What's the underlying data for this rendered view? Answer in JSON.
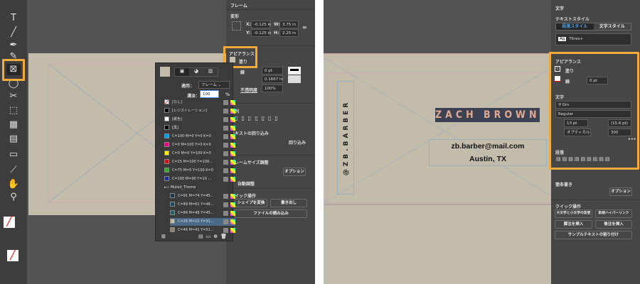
{
  "left": {
    "tools": [
      "select",
      "type-T",
      "line",
      "pen",
      "pencil",
      "rectangle-frame",
      "ellipse",
      "scissors",
      "free-transform",
      "gradient",
      "gradient-feather",
      "note",
      "eyedropper",
      "hand",
      "zoom"
    ],
    "properties": {
      "section_title": "フレーム",
      "transform_title": "変形",
      "x_label": "X:",
      "x": "-0.125 in",
      "y_label": "Y:",
      "y": "-0.125 in",
      "w_label": "W:",
      "w": "3.75 in",
      "h_label": "H:",
      "h": "2.25 in",
      "appearance_title": "アピアランス",
      "fill_label": "塗り",
      "stroke_label": "線",
      "stroke_weight": "0 pt",
      "corner": "0.1667 in",
      "opacity_label": "不透明度",
      "opacity": "100%",
      "align_title": "整列",
      "wrap_title": "テキストの回り込み",
      "wrap_checkbox": "回り込み",
      "fit_title": "フレームサイズ調整",
      "options_button": "オプション",
      "auto_fit": "自動調整",
      "quick_title": "クイック操作",
      "convert_shape": "シェイプを変換",
      "export_button": "書き出し",
      "place_file": "ファイルの読み込み"
    },
    "swatches": {
      "apply_label": "適用：",
      "apply_value": "フレーム",
      "tint_label": "濃淡：",
      "tint_value": "100",
      "tint_unit": "%",
      "items": [
        {
          "name": "[なし]",
          "color": "none"
        },
        {
          "name": "[レジストレーション]",
          "color": "#000000"
        },
        {
          "name": "[紙色]",
          "color": "#ffffff"
        },
        {
          "name": "[黒]",
          "color": "#000000"
        },
        {
          "name": "C=100 M=0 Y=0 K=0",
          "color": "#00a0e6"
        },
        {
          "name": "C=0 M=100 Y=0 K=0",
          "color": "#e4007f"
        },
        {
          "name": "C=0 M=0 Y=100 K=0",
          "color": "#fff100"
        },
        {
          "name": "C=15 M=100 Y=100...",
          "color": "#c8161d"
        },
        {
          "name": "C=75 M=5 Y=100 K=0",
          "color": "#3aa935"
        },
        {
          "name": "C=100 M=90 Y=10 ...",
          "color": "#1d2f86"
        }
      ],
      "group": "Muted_Theme",
      "group_items": [
        {
          "name": "C=91 M=74 Y=45...",
          "color": "#1f3447"
        },
        {
          "name": "C=89 M=61 Y=48...",
          "color": "#234a58"
        },
        {
          "name": "C=84 M=48 Y=45...",
          "color": "#2c5e68"
        },
        {
          "name": "C=26 M=22 Y=31...",
          "color": "#c3bcab",
          "selected": true
        },
        {
          "name": "C=46 M=41 Y=51...",
          "color": "#8d8574"
        }
      ]
    }
  },
  "right": {
    "card": {
      "handle": "@ZB.BARBER",
      "name": "ZACH BROWN",
      "email": "zb.barber@mail.com",
      "city": "Austin, TX"
    },
    "properties": {
      "section_title": "文字",
      "text_style_title": "テキストスタイル",
      "para_style_tab": "段落スタイル",
      "char_style_tab": "文字スタイル",
      "style_value": "Titres+",
      "appearance_title": "アピアランス",
      "fill_label": "塗り",
      "stroke_label": "線",
      "stroke_weight": "0 pt",
      "char_title": "文字",
      "font": "Gin",
      "font_style": "Regular",
      "size": "13 pt",
      "leading": "(15.6 pt)",
      "kerning": "オプティカル",
      "tracking": "300",
      "para_title": "段落",
      "bullets_title": "箇条書き",
      "options_button": "オプション",
      "quick_title": "クイック操作",
      "change_case": "大文字と小文字の変更",
      "new_hyperlink": "新規ハイパーリンク",
      "insert_footnote": "脚注を挿入",
      "insert_endnote": "後注を挿入",
      "fill_placeholder": "サンプルテキストの割り付け"
    }
  },
  "colors": {
    "highlight": "#f0ab3c",
    "paper": "#c3bcab",
    "name_bg": "#3c4254",
    "name_text": "#e0a890"
  }
}
